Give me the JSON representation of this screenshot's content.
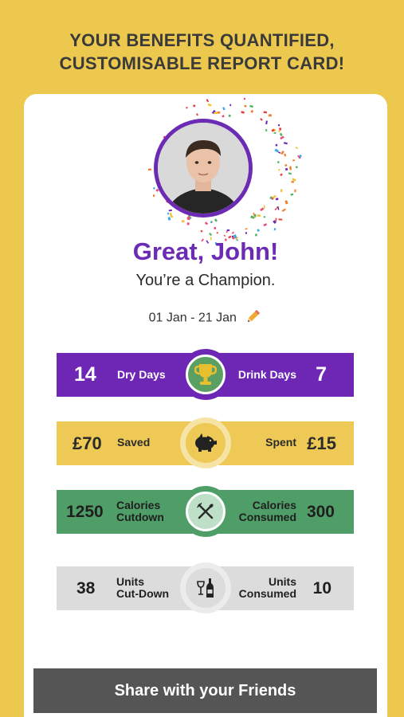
{
  "headline": {
    "line1": "YOUR BENEFITS QUANTIFIED,",
    "line2": "CUSTOMISABLE REPORT CARD!"
  },
  "profile": {
    "greeting": "Great, John!",
    "subtitle": "You’re a Champion."
  },
  "date_range": "01 Jan - 21 Jan",
  "stats": {
    "drink": {
      "left_value": "14",
      "left_label": "Dry Days",
      "right_label": "Drink Days",
      "right_value": "7",
      "icon": "trophy-icon",
      "color": "#6e27b5"
    },
    "money": {
      "left_value": "£70",
      "left_label": "Saved",
      "right_label": "Spent",
      "right_value": "£15",
      "icon": "piggy-bank-icon",
      "color": "#eec955"
    },
    "calories": {
      "left_value": "1250",
      "left_label_1": "Calories",
      "left_label_2": "Cutdown",
      "right_label_1": "Calories",
      "right_label_2": "Consumed",
      "right_value": "300",
      "icon": "fork-knife-icon",
      "color": "#4f9e67"
    },
    "units": {
      "left_value": "38",
      "left_label_1": "Units",
      "left_label_2": "Cut-Down",
      "right_label_1": "Units",
      "right_label_2": "Consumed",
      "right_value": "10",
      "icon": "wine-bottle-icon",
      "color": "#dcdcdc"
    }
  },
  "share_button": "Share with your Friends"
}
